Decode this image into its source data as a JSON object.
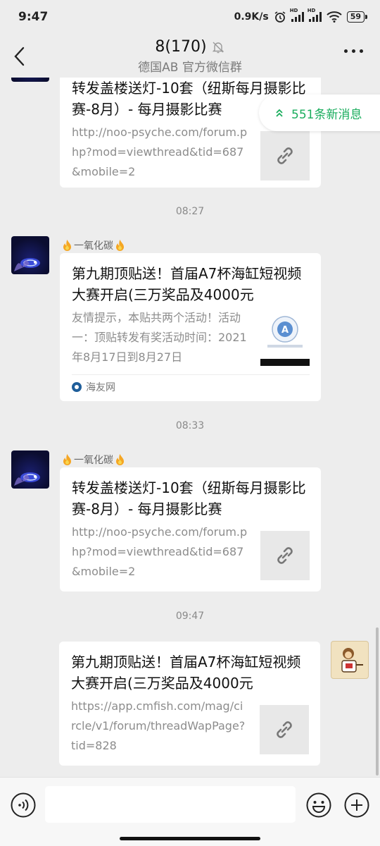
{
  "status": {
    "time": "9:47",
    "speed": "0.9K/s",
    "battery": "59",
    "signal_label": "HD"
  },
  "header": {
    "title": "8(170)",
    "subtitle": "德国AB  官方微信群"
  },
  "new_messages": {
    "label": "551条新消息"
  },
  "messages": [
    {
      "title": "转发盖楼送灯-10套（纽斯每月摄影比赛-8月）- 每月摄影比赛",
      "desc": "http://noo-psyche.com/forum.php?mod=viewthread&tid=687&mobile=2"
    },
    {
      "time": "08:27",
      "sender": "一氧化碳",
      "title": "第九期顶贴送！首届A7杯海缸短视频大赛开启(三万奖品及4000元",
      "desc": "友情提示，本贴共两个活动！活动一：顶贴转发有奖活动时间：2021年8月17日到8月27日",
      "source": "海友网"
    },
    {
      "time": "08:33",
      "sender": "一氧化碳",
      "title": "转发盖楼送灯-10套（纽斯每月摄影比赛-8月）- 每月摄影比赛",
      "desc": "http://noo-psyche.com/forum.php?mod=viewthread&tid=687&mobile=2"
    },
    {
      "time": "09:47",
      "title": "第九期顶贴送！首届A7杯海缸短视频大赛开启(三万奖品及4000元",
      "desc": "https://app.cmfish.com/mag/circle/v1/forum/threadWapPage?tid=828"
    }
  ],
  "colors": {
    "background": "#ededed",
    "accent_green": "#1aad5d"
  }
}
